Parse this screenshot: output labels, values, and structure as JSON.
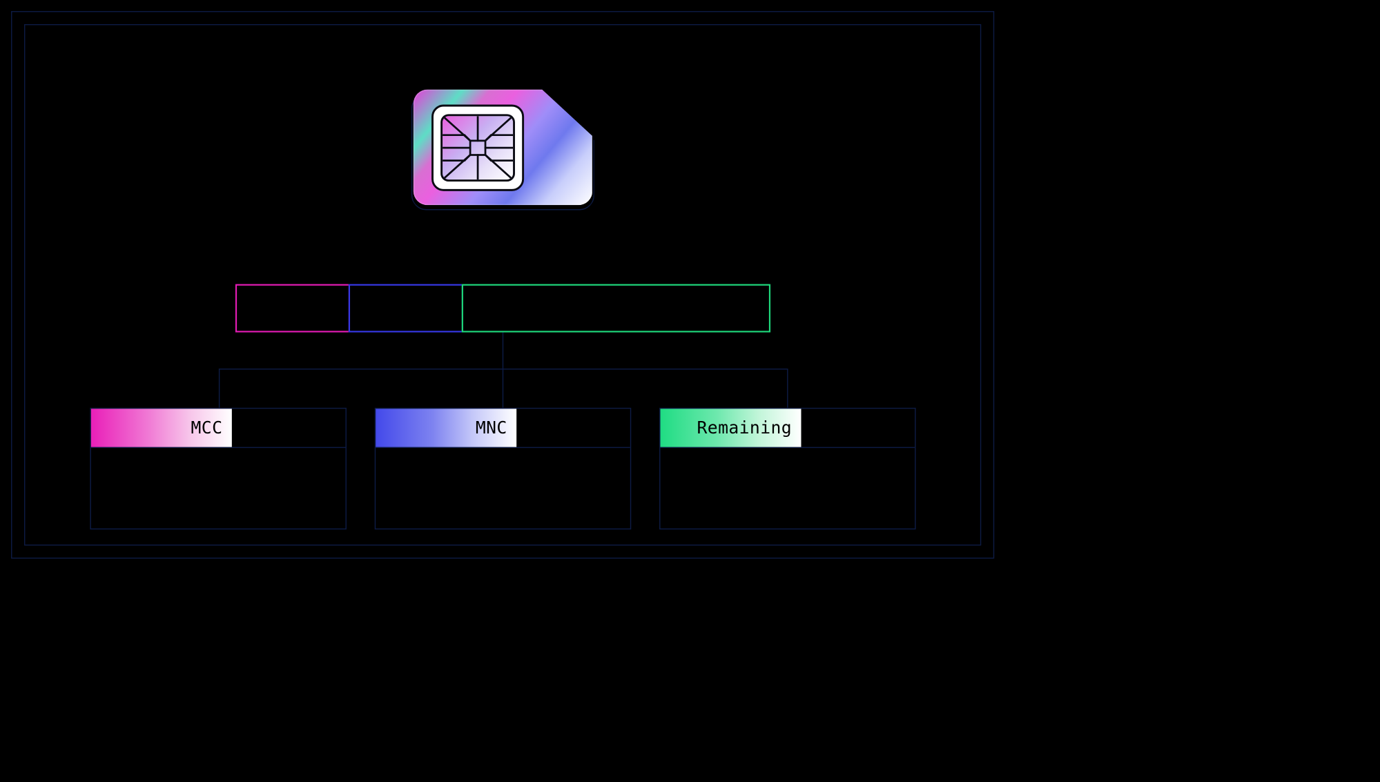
{
  "colors": {
    "mcc": "#e31bb4",
    "mnc": "#3638e6",
    "remaining": "#1ed87b",
    "frame": "#0d1b44"
  },
  "icon": "sim-card-icon",
  "segments": [
    {
      "id": "mcc",
      "color_key": "mcc"
    },
    {
      "id": "mnc",
      "color_key": "mnc"
    },
    {
      "id": "remaining",
      "color_key": "remaining"
    }
  ],
  "cards": [
    {
      "id": "mcc",
      "label": "MCC"
    },
    {
      "id": "mnc",
      "label": "MNC"
    },
    {
      "id": "remaining",
      "label": "Remaining"
    }
  ]
}
